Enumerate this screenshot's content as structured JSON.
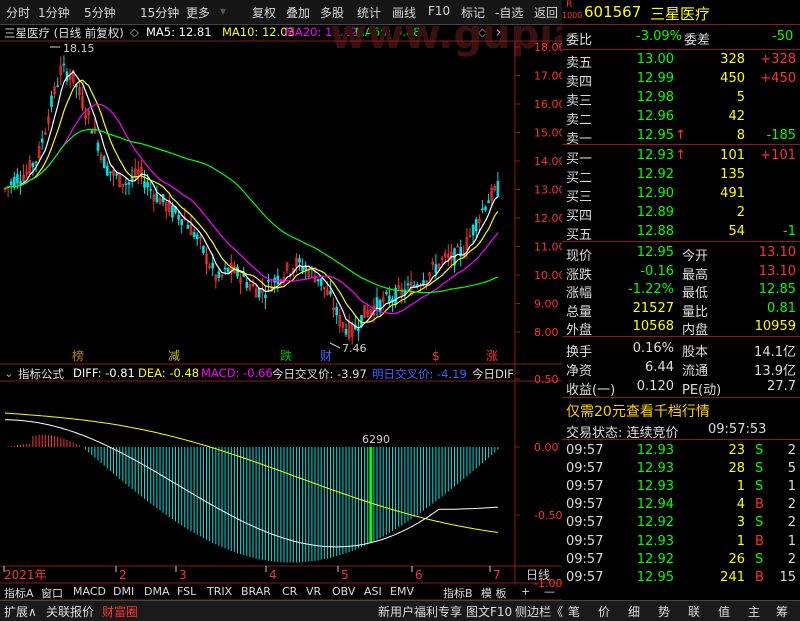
{
  "toolbar": {
    "items": [
      "分时",
      "1分钟",
      "5分钟",
      "15分钟",
      "更多",
      "复权",
      "叠加",
      "多股",
      "统计",
      "画线",
      "F10",
      "标记",
      "-自选",
      "返回"
    ]
  },
  "chart_header": {
    "stock_label": "三星医疗 (日线 前复权)",
    "ma5": "MA5: 12.81",
    "ma10": "MA10: 12.03",
    "ma20": "MA20: 11.12",
    "ma60": "MA60: 9.88",
    "watermark": "www.gupiao.cn",
    "high_note": "18.15",
    "low_note": "7.46"
  },
  "price_axis": [
    "18.00",
    "17.00",
    "16.00",
    "15.00",
    "14.00",
    "13.00",
    "12.00",
    "11.00",
    "10.00",
    "9.00",
    "8.00"
  ],
  "event_markers": [
    {
      "text": "榜",
      "color": "#c08000"
    },
    {
      "text": "减",
      "color": "#c0c000"
    },
    {
      "text": "跌",
      "color": "#00c000"
    },
    {
      "text": "财",
      "color": "#4060ff"
    },
    {
      "text": "$",
      "color": "#ff3030"
    },
    {
      "text": "涨",
      "color": "#ff3030"
    }
  ],
  "indicator_header": {
    "name": "指标公式",
    "diff": "DIFF: -0.81",
    "dea": "DEA: -0.48",
    "macd": "MACD: -0.66",
    "cross_today": "今日交叉价: -3.97",
    "cross_tomorrow": "明日交叉价: -4.19",
    "today_dif": "今日DIF",
    "peak_note": "6290"
  },
  "macd_axis": [
    "0.50",
    "0.00",
    "-0.50",
    "-1.00"
  ],
  "date_axis": [
    "2021年",
    "2",
    "3",
    "4",
    "5",
    "6",
    "7"
  ],
  "daily_label": "日线",
  "bottom_tabs": [
    "指标A",
    "窗口",
    "MACD",
    "DMI",
    "DMA",
    "FSL",
    "TRIX",
    "BRAR",
    "CR",
    "VR",
    "OBV",
    "ASI",
    "EMV",
    "指标B",
    "模 板",
    "+",
    "—"
  ],
  "footer": {
    "left": [
      "扩展∧",
      "关联报价",
      "财富圈"
    ],
    "mid": [
      "新用户福利专享",
      "图文F10",
      "侧边栏《"
    ],
    "right": [
      "笔",
      "价",
      "细",
      "势",
      "联",
      "值",
      "主",
      "筹"
    ]
  },
  "quote": {
    "badge_top": "R",
    "badge_bottom": "1000",
    "code": "601567",
    "name": "三星医疗",
    "weibi_label": "委比",
    "weibi": "-3.09%",
    "weicha_label": "委差",
    "weicha": "-50",
    "asks": [
      {
        "label": "卖五",
        "price": "13.00",
        "vol": "328",
        "chg": "+328",
        "arrow": ""
      },
      {
        "label": "卖四",
        "price": "12.99",
        "vol": "450",
        "chg": "+450",
        "arrow": ""
      },
      {
        "label": "卖三",
        "price": "12.98",
        "vol": "5",
        "chg": "",
        "arrow": ""
      },
      {
        "label": "卖二",
        "price": "12.96",
        "vol": "42",
        "chg": "",
        "arrow": ""
      },
      {
        "label": "卖一",
        "price": "12.95",
        "vol": "8",
        "chg": "-185",
        "arrow": "↑"
      }
    ],
    "bids": [
      {
        "label": "买一",
        "price": "12.93",
        "vol": "101",
        "chg": "+101",
        "arrow": "↑"
      },
      {
        "label": "买二",
        "price": "12.92",
        "vol": "135",
        "chg": "",
        "arrow": ""
      },
      {
        "label": "买三",
        "price": "12.90",
        "vol": "491",
        "chg": "",
        "arrow": ""
      },
      {
        "label": "买四",
        "price": "12.89",
        "vol": "2",
        "chg": "",
        "arrow": ""
      },
      {
        "label": "买五",
        "price": "12.88",
        "vol": "54",
        "chg": "-1",
        "arrow": ""
      }
    ],
    "stats": [
      {
        "l1": "现价",
        "v1": "12.95",
        "l2": "今开",
        "v2": "13.10"
      },
      {
        "l1": "涨跌",
        "v1": "-0.16",
        "l2": "最高",
        "v2": "13.10"
      },
      {
        "l1": "涨幅",
        "v1": "-1.22%",
        "l2": "最低",
        "v2": "12.85"
      },
      {
        "l1": "总量",
        "v1": "21527",
        "l2": "量比",
        "v2": "0.81"
      },
      {
        "l1": "外盘",
        "v1": "10568",
        "l2": "内盘",
        "v2": "10959"
      }
    ],
    "stats2": [
      {
        "l1": "换手",
        "v1": "0.16%",
        "l2": "股本",
        "v2": "14.1亿"
      },
      {
        "l1": "净资",
        "v1": "6.44",
        "l2": "流通",
        "v2": "13.9亿"
      },
      {
        "l1": "收益(一)",
        "v1": "0.120",
        "l2": "PE(动)",
        "v2": "27.7"
      }
    ],
    "promo": "仅需20元查看千档行情",
    "trade_state": "交易状态: 连续竞价",
    "trade_time": "09:57:53",
    "ticks": [
      {
        "t": "09:57",
        "p": "12.93",
        "v": "23",
        "s": "S",
        "n": "2"
      },
      {
        "t": "09:57",
        "p": "12.93",
        "v": "28",
        "s": "S",
        "n": "5"
      },
      {
        "t": "09:57",
        "p": "12.93",
        "v": "1",
        "s": "S",
        "n": "1"
      },
      {
        "t": "09:57",
        "p": "12.94",
        "v": "4",
        "s": "B",
        "n": "2"
      },
      {
        "t": "09:57",
        "p": "12.92",
        "v": "3",
        "s": "S",
        "n": "2"
      },
      {
        "t": "09:57",
        "p": "12.93",
        "v": "1",
        "s": "B",
        "n": "1"
      },
      {
        "t": "09:57",
        "p": "12.92",
        "v": "26",
        "s": "S",
        "n": "2"
      },
      {
        "t": "09:57",
        "p": "12.95",
        "v": "241",
        "s": "B",
        "n": "15"
      }
    ]
  },
  "colors": {
    "up": "#ff3333",
    "down": "#00e0e0",
    "ma5": "#ffffff",
    "ma10": "#ffff00",
    "ma20": "#ff00ff",
    "ma60": "#00ff00",
    "grid": "#8b1a1a",
    "ask": "#00ff00",
    "vol": "#ffff00"
  }
}
